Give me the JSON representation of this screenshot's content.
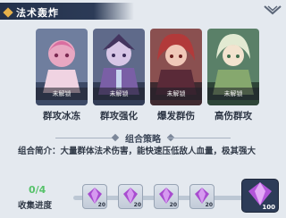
{
  "header": {
    "title": "法术轰炸"
  },
  "cards": [
    {
      "name": "群攻冰冻",
      "status": "未解锁",
      "colors": [
        "#6f7e9e",
        "#3d4a66"
      ]
    },
    {
      "name": "群攻强化",
      "status": "未解锁",
      "colors": [
        "#5f6a8a",
        "#323c55"
      ]
    },
    {
      "name": "爆发群伤",
      "status": "未解锁",
      "colors": [
        "#8a5050",
        "#3f2a30"
      ]
    },
    {
      "name": "高伤群攻",
      "status": "未解锁",
      "colors": [
        "#5a8068",
        "#2e4538"
      ]
    }
  ],
  "combo": {
    "section_title": "组合策略",
    "description": "组合简介：大量群体法术伤害，能快速压低敌人血量，极其强大"
  },
  "progress": {
    "value": "0/4",
    "current": 0,
    "total": 4,
    "label": "收集进度"
  },
  "rewards": [
    {
      "qty": "20",
      "icon": "purple-gem-icon"
    },
    {
      "qty": "20",
      "icon": "purple-gem-icon"
    },
    {
      "qty": "20",
      "icon": "purple-gem-icon"
    },
    {
      "qty": "20",
      "icon": "purple-gem-icon"
    },
    {
      "qty": "100",
      "icon": "purple-gem-icon"
    }
  ]
}
